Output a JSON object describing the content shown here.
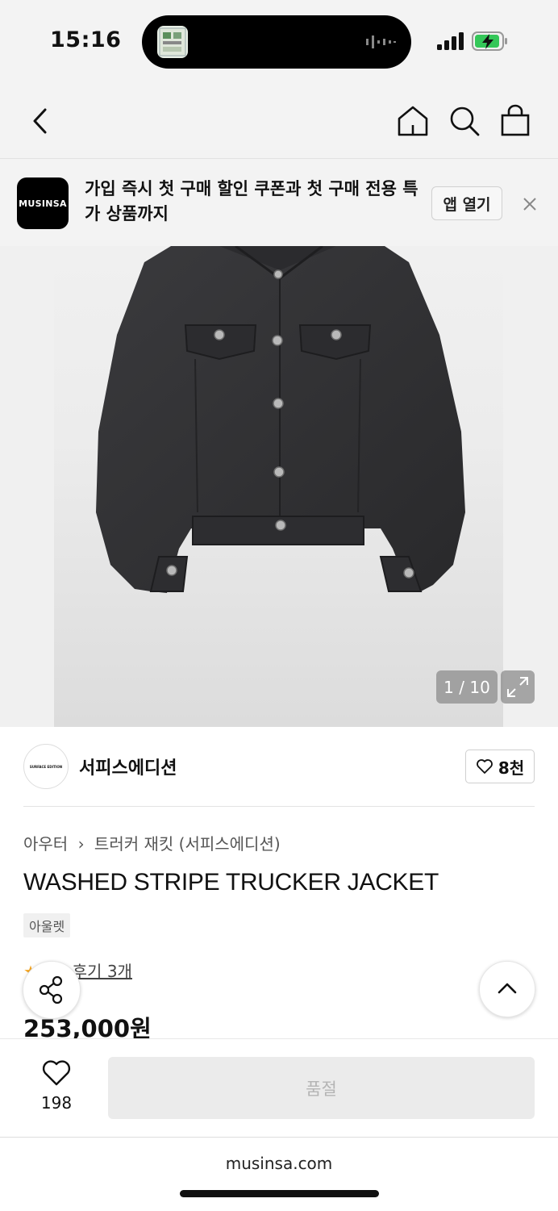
{
  "status_bar": {
    "time": "15:16"
  },
  "nav": {
    "icons": [
      "back-icon",
      "home-icon",
      "search-icon",
      "cart-icon"
    ]
  },
  "banner": {
    "logo_text": "MUSINSA",
    "message": "가입 즉시 첫 구매 할인 쿠폰과 첫 구매 전용 특가 상품까지",
    "open_app_label": "앱 열기"
  },
  "gallery": {
    "counter": "1 / 10",
    "current": 1,
    "total": 10
  },
  "brand": {
    "logo_text": "SURFACE EDITION",
    "name": "서피스에디션",
    "likes": "8천"
  },
  "product": {
    "breadcrumb_1": "아우터",
    "breadcrumb_2": "트러커 재킷 (서피스에디션)",
    "title": "WASHED STRIPE TRUCKER JACKET",
    "tag": "아울렛",
    "review_label": "후기 3개",
    "price": "253,000원"
  },
  "action_bar": {
    "wish_count": "198",
    "soldout_label": "품절"
  },
  "browser": {
    "url": "musinsa.com"
  },
  "colors": {
    "accent_star": "#f5a623",
    "battery_green": "#34c759",
    "soldout_bg": "#ebebeb"
  }
}
